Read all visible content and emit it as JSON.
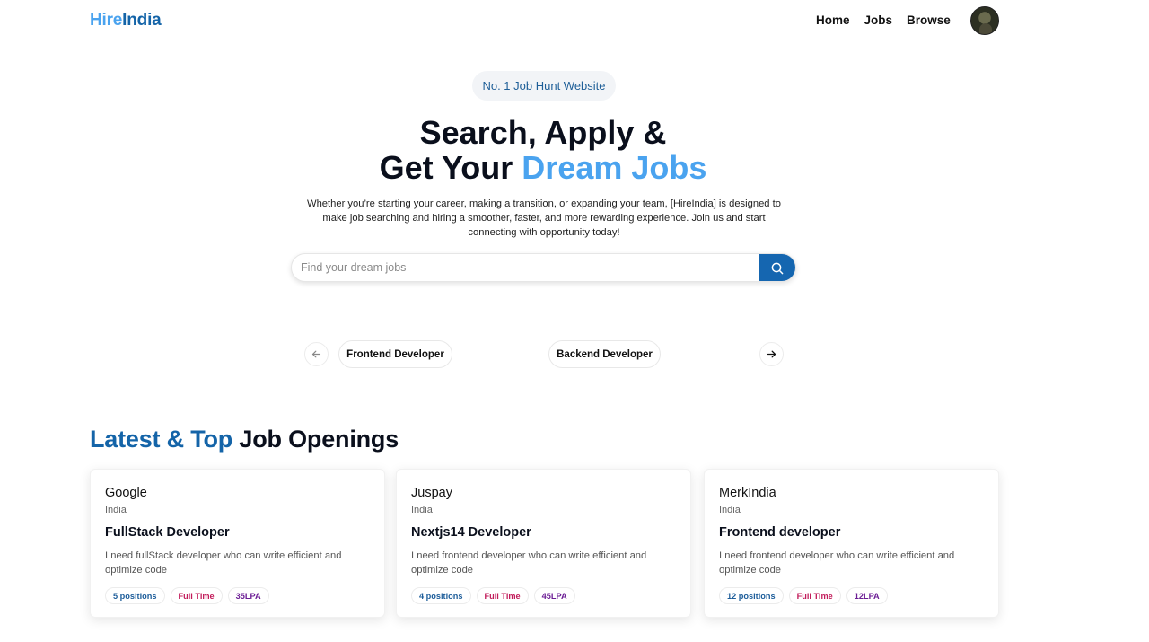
{
  "nav": {
    "logo_part1": "Hire",
    "logo_part2": "India",
    "links": [
      "Home",
      "Jobs",
      "Browse"
    ],
    "avatar_icon": "user-avatar-icon"
  },
  "hero": {
    "badge": "No. 1 Job Hunt Website",
    "title_line1": "Search, Apply &",
    "title_line2_plain": "Get Your ",
    "title_line2_accent": "Dream Jobs",
    "description": "Whether you’re starting your career, making a transition, or expanding your team, [HireIndia] is designed to make job searching and hiring a smoother, faster, and more rewarding experience. Join us and start connecting with opportunity today!",
    "search_placeholder": "Find your dream jobs",
    "search_icon": "search-icon"
  },
  "carousel": {
    "prev_icon": "arrow-left-icon",
    "next_icon": "arrow-right-icon",
    "items": [
      "Frontend Developer",
      "Backend Developer"
    ]
  },
  "jobs_section": {
    "title_accent": "Latest & Top",
    "title_plain": " Job Openings",
    "cards": [
      {
        "company": "Google",
        "location": "India",
        "role": "FullStack Developer",
        "description": "I need fullStack developer who can write efficient and optimize code",
        "positions": "5 positions",
        "job_type": "Full Time",
        "salary": "35LPA"
      },
      {
        "company": "Juspay",
        "location": "India",
        "role": "Nextjs14 Developer",
        "description": "I need frontend developer who can write efficient and optimize code",
        "positions": "4 positions",
        "job_type": "Full Time",
        "salary": "45LPA"
      },
      {
        "company": "MerkIndia",
        "location": "India",
        "role": "Frontend developer",
        "description": "I need frontend developer who can write efficient and optimize code",
        "positions": "12 positions",
        "job_type": "Full Time",
        "salary": "12LPA"
      }
    ]
  },
  "colors": {
    "brand_light": "#4aa3ef",
    "brand_dark": "#1464a8",
    "search_button": "#1566b0",
    "tag_positions": "#1d5d9a",
    "tag_job_type": "#c21b5a",
    "tag_salary": "#6c1d95"
  }
}
